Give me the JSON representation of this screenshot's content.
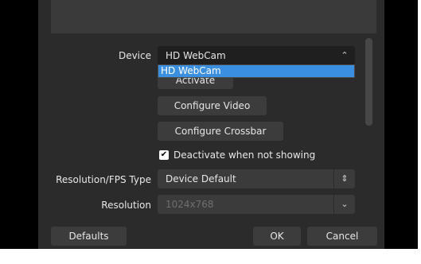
{
  "device": {
    "label": "Device",
    "value": "HD WebCam",
    "dropdown_option": "HD WebCam"
  },
  "buttons": {
    "activate": "Activate",
    "configure_video": "Configure Video",
    "configure_crossbar": "Configure Crossbar",
    "defaults": "Defaults",
    "ok": "OK",
    "cancel": "Cancel"
  },
  "deactivate": {
    "label": "Deactivate when not showing",
    "checked": true
  },
  "resolution_fps_type": {
    "label": "Resolution/FPS Type",
    "value": "Device Default"
  },
  "resolution": {
    "label": "Resolution",
    "value": "1024x768",
    "disabled": true
  },
  "icons": {
    "updown": "updown-chevron-icon",
    "down": "chevron-down-icon",
    "check": "checkmark-icon"
  }
}
